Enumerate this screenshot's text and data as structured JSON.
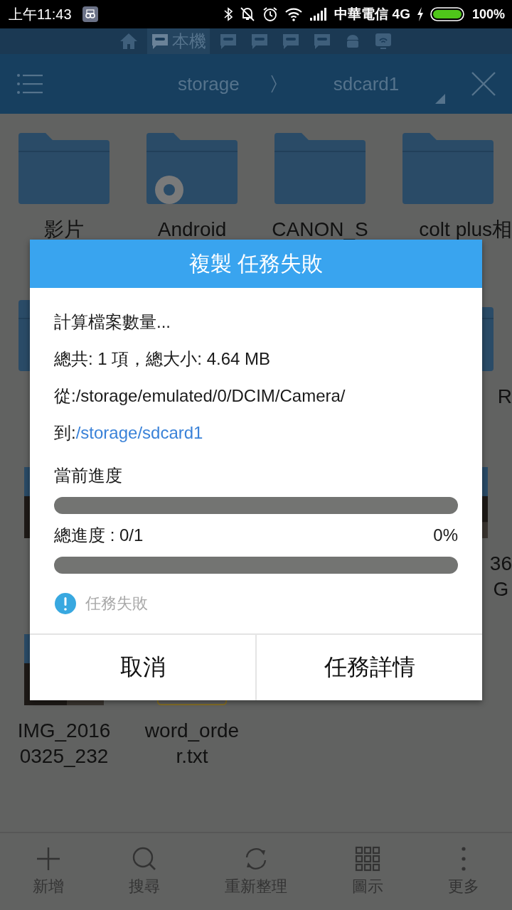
{
  "status_bar": {
    "time": "上午11:43",
    "carrier": "中華電信 4G",
    "battery": "100%"
  },
  "storage_tabs": [
    {
      "kind": "home",
      "selected": false
    },
    {
      "kind": "sd",
      "label": "本機",
      "selected": true
    },
    {
      "kind": "sd",
      "selected": false
    },
    {
      "kind": "sd",
      "selected": false
    },
    {
      "kind": "sd",
      "selected": false
    },
    {
      "kind": "sd",
      "selected": false
    },
    {
      "kind": "android",
      "selected": false
    },
    {
      "kind": "cast",
      "selected": false
    }
  ],
  "path_bar": {
    "segments": [
      "storage",
      "sdcard1"
    ]
  },
  "files": [
    {
      "kind": "folder",
      "label_lines": [
        "影片"
      ]
    },
    {
      "kind": "settings_folder",
      "label_lines": [
        "Android"
      ]
    },
    {
      "kind": "folder",
      "label_lines": [
        "CANON_S"
      ]
    },
    {
      "kind": "folder",
      "label_lines": [
        "colt plus相"
      ]
    },
    {
      "kind": "folder"
    },
    {
      "kind": "hidden"
    },
    {
      "kind": "hidden"
    },
    {
      "kind": "folder",
      "label_lines": [
        "R"
      ]
    },
    {
      "kind": "picture"
    },
    {
      "kind": "hidden"
    },
    {
      "kind": "hidden"
    },
    {
      "kind": "picture",
      "label_lines": [
        "36",
        "G"
      ]
    },
    {
      "kind": "picture",
      "label_lines": [
        "IMG_2016",
        "0325_232"
      ]
    },
    {
      "kind": "text_file",
      "label_lines": [
        "word_orde",
        "r.txt"
      ]
    }
  ],
  "dialog": {
    "title": "複製 任務失敗",
    "counting": "計算檔案數量...",
    "total": "總共: 1 項，總大小: 4.64 MB",
    "from": "從:/storage/emulated/0/DCIM/Camera/",
    "to_label": "到:",
    "to_path": "/storage/sdcard1",
    "current_progress": {
      "label": "當前進度",
      "level": 0
    },
    "overall_progress": {
      "label": "總進度 : 0/1",
      "percent": "0%",
      "level": 0
    },
    "status": {
      "kind": "failed",
      "text": "任務失敗"
    },
    "buttons": [
      "取消",
      "任務詳情"
    ]
  },
  "toolbar": [
    {
      "kind": "add",
      "label": "新增"
    },
    {
      "kind": "search",
      "label": "搜尋"
    },
    {
      "kind": "refresh",
      "label": "重新整理"
    },
    {
      "kind": "grid",
      "label": "圖示"
    },
    {
      "kind": "more",
      "label": "更多"
    }
  ]
}
